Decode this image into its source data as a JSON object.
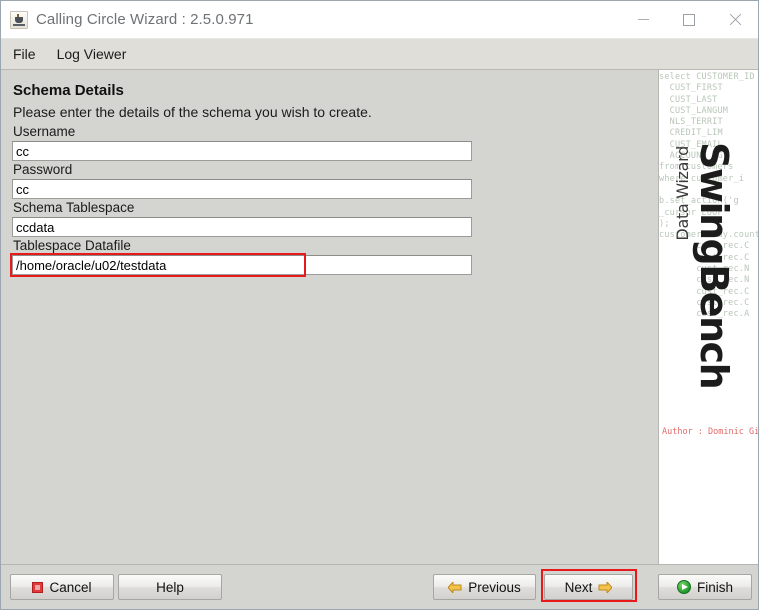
{
  "window": {
    "title": "Calling Circle Wizard : 2.5.0.971",
    "app_icon": "java-cup-icon",
    "controls": {
      "minimize": "minimize-icon",
      "maximize": "maximize-icon",
      "close": "close-icon"
    }
  },
  "menubar": {
    "items": [
      {
        "label": "File"
      },
      {
        "label": "Log Viewer"
      }
    ]
  },
  "page": {
    "heading": "Schema Details",
    "subheading": "Please enter the details of the schema you wish to create."
  },
  "form": {
    "fields": [
      {
        "label": "Username",
        "value": "cc",
        "highlighted": false
      },
      {
        "label": "Password",
        "value": "cc",
        "highlighted": false
      },
      {
        "label": "Schema Tablespace",
        "value": "ccdata",
        "highlighted": false
      },
      {
        "label": "Tablespace Datafile",
        "value": "/home/oracle/u02/testdata",
        "highlighted": true
      }
    ]
  },
  "banner": {
    "title": "SwingBench",
    "subtitle": "Data Wizard",
    "author": "Author : Dominic Giles",
    "code_background": "select CUSTOMER_ID\n  CUST_FIRST\n  CUST_LAST\n  CUST_LANGUM\n  NLS_TERRIT\n  CREDIT_LIM\n  CUST_EMAIL\n  ACCOUNT_MG\nfrom customers\nwhere customer_i\n\nb.set_action('g\n_cursor LOOP\n);\ncustomerArray.count)\n       cust_rec.C\n       cust_rec.C\n       cust_rec.N\n       cust_rec.N\n       cust_rec.C\n       cust_rec.C\n       cust_rec.A"
  },
  "buttons": {
    "cancel": {
      "label": "Cancel",
      "icon": "stop-icon",
      "highlighted": false
    },
    "help": {
      "label": "Help",
      "icon": "",
      "highlighted": false
    },
    "previous": {
      "label": "Previous",
      "icon": "arrow-left-icon",
      "highlighted": false
    },
    "next": {
      "label": "Next",
      "icon": "arrow-right-icon",
      "highlighted": true
    },
    "finish": {
      "label": "Finish",
      "icon": "play-icon",
      "highlighted": false
    }
  },
  "colors": {
    "panel": "#d4d4d0",
    "highlight": "#e8191b",
    "accent_arrow": "#f2c24a",
    "finish_green": "#1f9a2e"
  }
}
